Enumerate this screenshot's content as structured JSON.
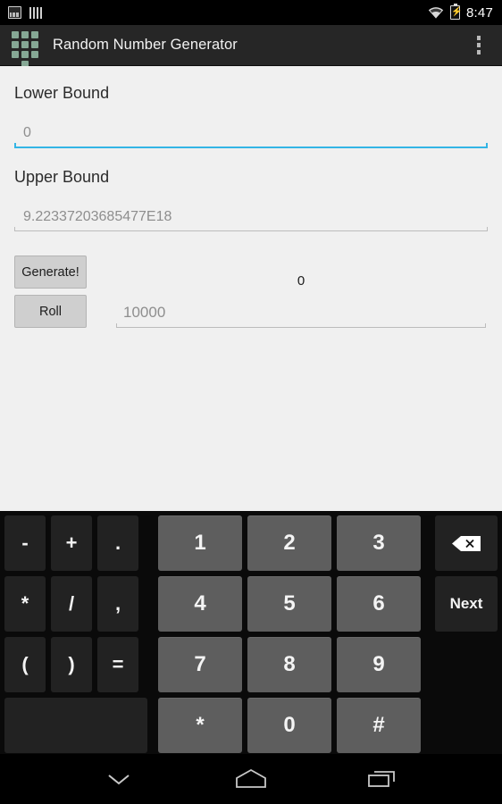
{
  "status_bar": {
    "time": "8:47",
    "left_icons": [
      "screenshot-icon",
      "bars-icon"
    ],
    "right_icons": [
      "wifi-icon",
      "battery-charging-icon"
    ]
  },
  "action_bar": {
    "app_icon": "dice-grid-icon",
    "title": "Random Number Generator",
    "overflow_menu": "overflow-menu-icon"
  },
  "form": {
    "lower_bound": {
      "label": "Lower Bound",
      "value": "",
      "placeholder": "0",
      "focused": true,
      "accent_color": "#33b5e5"
    },
    "upper_bound": {
      "label": "Upper Bound",
      "value": "",
      "placeholder": "9.22337203685477E18",
      "focused": false,
      "line_color": "#bcbcbc"
    },
    "generate_button": "Generate!",
    "roll_button": "Roll",
    "result_value": "0",
    "roll_count": {
      "value": "",
      "placeholder": "10000"
    }
  },
  "keyboard": {
    "rows": [
      {
        "function_keys": [
          "-",
          "+",
          "."
        ],
        "number_keys": [
          "1",
          "2",
          "3"
        ],
        "side_key": {
          "label": "",
          "icon": "backspace-icon"
        }
      },
      {
        "function_keys": [
          "*",
          "/",
          ","
        ],
        "number_keys": [
          "4",
          "5",
          "6"
        ],
        "side_key": {
          "label": "Next",
          "icon": ""
        }
      },
      {
        "function_keys": [
          "(",
          ")",
          "="
        ],
        "number_keys": [
          "7",
          "8",
          "9"
        ],
        "side_key": null
      },
      {
        "function_keys": [
          ""
        ],
        "number_keys": [
          "*",
          "0",
          "#"
        ],
        "side_key": null
      }
    ],
    "key_color_function": "#222222",
    "key_color_number": "#5e5e5e"
  },
  "nav_bar": {
    "back": "hide-keyboard-icon",
    "home": "home-icon",
    "recents": "recents-icon"
  },
  "theme": {
    "status_bar_bg": "#000000",
    "action_bar_bg": "#262626",
    "content_bg": "#f0f0f0",
    "accent": "#33b5e5",
    "app_icon_color": "#86a895"
  }
}
